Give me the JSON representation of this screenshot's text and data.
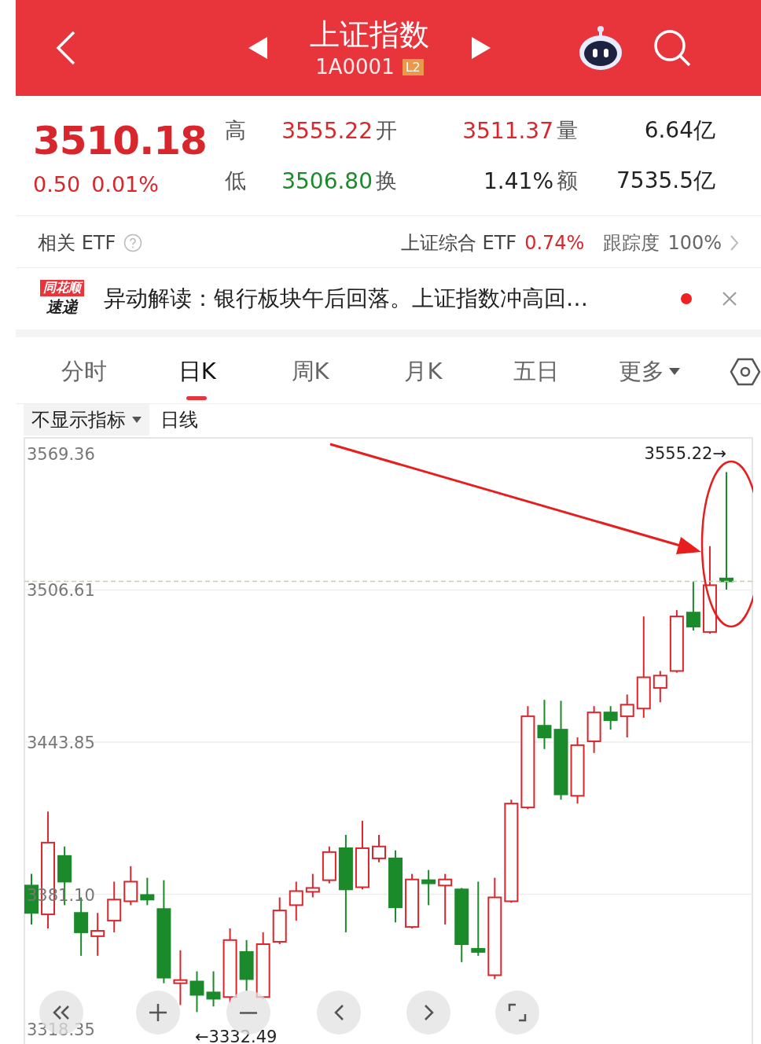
{
  "header": {
    "title": "上证指数",
    "code": "1A0001",
    "badge": "L2"
  },
  "quote": {
    "price": "3510.18",
    "change": "0.50",
    "change_pct": "0.01%",
    "stats": [
      {
        "label": "高",
        "value": "3555.22",
        "color": "#d8262d"
      },
      {
        "label": "开",
        "value": "3511.37",
        "color": "#d8262d"
      },
      {
        "label": "量",
        "value": "6.64亿",
        "color": "#222222"
      },
      {
        "label": "低",
        "value": "3506.80",
        "color": "#1b8a2a"
      },
      {
        "label": "换",
        "value": "1.41%",
        "color": "#222222"
      },
      {
        "label": "额",
        "value": "7535.5亿",
        "color": "#222222"
      }
    ]
  },
  "etf": {
    "label": "相关 ETF",
    "fund": "上证综合 ETF",
    "fund_change": "0.74%",
    "track_label": "跟踪度",
    "track_value": "100%"
  },
  "news": {
    "source": [
      "同花顺",
      "速递"
    ],
    "text": "异动解读：银行板块午后回落。上证指数冲高回…",
    "unread": true
  },
  "tabs": [
    {
      "label": "分时",
      "selected": false,
      "kind": "tab"
    },
    {
      "label": "日K",
      "selected": true,
      "kind": "tab"
    },
    {
      "label": "周K",
      "selected": false,
      "kind": "tab"
    },
    {
      "label": "月K",
      "selected": false,
      "kind": "tab"
    },
    {
      "label": "五日",
      "selected": false,
      "kind": "tab"
    },
    {
      "label": "更多",
      "selected": false,
      "kind": "dropdown"
    }
  ],
  "chart": {
    "indicator": "不显示指标",
    "period": "日线",
    "high_marker": "3555.22→",
    "low_marker": "←3332.49",
    "chart_data": {
      "type": "candlestick",
      "ohlc": [
        [
          3384.7,
          3389.5,
          3368.6,
          3373.4
        ],
        [
          3372.8,
          3415.2,
          3367.0,
          3402.4
        ],
        [
          3396.9,
          3400.8,
          3376.6,
          3386.3
        ],
        [
          3373.4,
          3379.8,
          3355.7,
          3365.4
        ],
        [
          3363.8,
          3373.4,
          3355.7,
          3366.0
        ],
        [
          3370.2,
          3386.3,
          3365.4,
          3378.9
        ],
        [
          3378.2,
          3392.7,
          3376.6,
          3386.3
        ],
        [
          3380.8,
          3387.9,
          3376.6,
          3378.9
        ],
        [
          3375.0,
          3386.9,
          3344.4,
          3346.7
        ],
        [
          3344.4,
          3358.0,
          3335.4,
          3345.7
        ],
        [
          3345.1,
          3349.3,
          3332.49,
          3339.6
        ],
        [
          3340.6,
          3349.3,
          3334.8,
          3338.0
        ],
        [
          3338.7,
          3367.0,
          3336.4,
          3362.2
        ],
        [
          3357.3,
          3362.2,
          3341.2,
          3346.1
        ],
        [
          3338.7,
          3365.4,
          3338.0,
          3360.5
        ],
        [
          3361.5,
          3379.8,
          3360.5,
          3374.4
        ],
        [
          3376.6,
          3386.3,
          3370.2,
          3382.4
        ],
        [
          3382.1,
          3389.5,
          3379.8,
          3383.7
        ],
        [
          3386.9,
          3400.8,
          3385.6,
          3398.5
        ],
        [
          3400.1,
          3405.6,
          3365.4,
          3383.1
        ],
        [
          3384.0,
          3411.4,
          3383.1,
          3400.1
        ],
        [
          3395.9,
          3405.6,
          3394.3,
          3400.8
        ],
        [
          3395.9,
          3399.2,
          3369.5,
          3375.7
        ],
        [
          3367.6,
          3389.5,
          3367.0,
          3387.2
        ],
        [
          3386.9,
          3391.1,
          3376.6,
          3385.6
        ],
        [
          3384.7,
          3389.5,
          3368.6,
          3387.2
        ],
        [
          3383.1,
          3383.7,
          3353.1,
          3360.5
        ],
        [
          3358.6,
          3386.3,
          3355.7,
          3357.3
        ],
        [
          3347.7,
          3387.9,
          3346.1,
          3379.8
        ],
        [
          3378.2,
          3420.1,
          3377.6,
          3418.5
        ],
        [
          3416.9,
          3458.7,
          3416.2,
          3454.5
        ],
        [
          3450.6,
          3461.3,
          3441.0,
          3445.8
        ],
        [
          3449.0,
          3460.9,
          3420.1,
          3422.3
        ],
        [
          3421.7,
          3445.8,
          3418.5,
          3442.6
        ],
        [
          3444.2,
          3458.7,
          3439.4,
          3456.1
        ],
        [
          3456.1,
          3458.7,
          3449.0,
          3452.9
        ],
        [
          3454.5,
          3463.5,
          3445.8,
          3459.3
        ],
        [
          3457.7,
          3495.7,
          3453.9,
          3470.6
        ],
        [
          3466.2,
          3473.2,
          3460.3,
          3471.3
        ],
        [
          3473.2,
          3498.3,
          3472.5,
          3495.7
        ],
        [
          3497.3,
          3510.2,
          3489.9,
          3491.5
        ],
        [
          3489.3,
          3524.7,
          3488.6,
          3508.6
        ],
        [
          3511.37,
          3555.22,
          3506.8,
          3510.18
        ]
      ],
      "ylim": [
        3318.35,
        3569.36
      ],
      "yticks": [
        {
          "value": 3569.36,
          "label": "3569.36"
        },
        {
          "value": 3506.61,
          "label": "3506.61"
        },
        {
          "value": 3443.85,
          "label": "3443.85"
        },
        {
          "value": 3381.1,
          "label": "3381.10"
        },
        {
          "value": 3318.35,
          "label": "3318.35"
        }
      ],
      "grid": true
    }
  }
}
